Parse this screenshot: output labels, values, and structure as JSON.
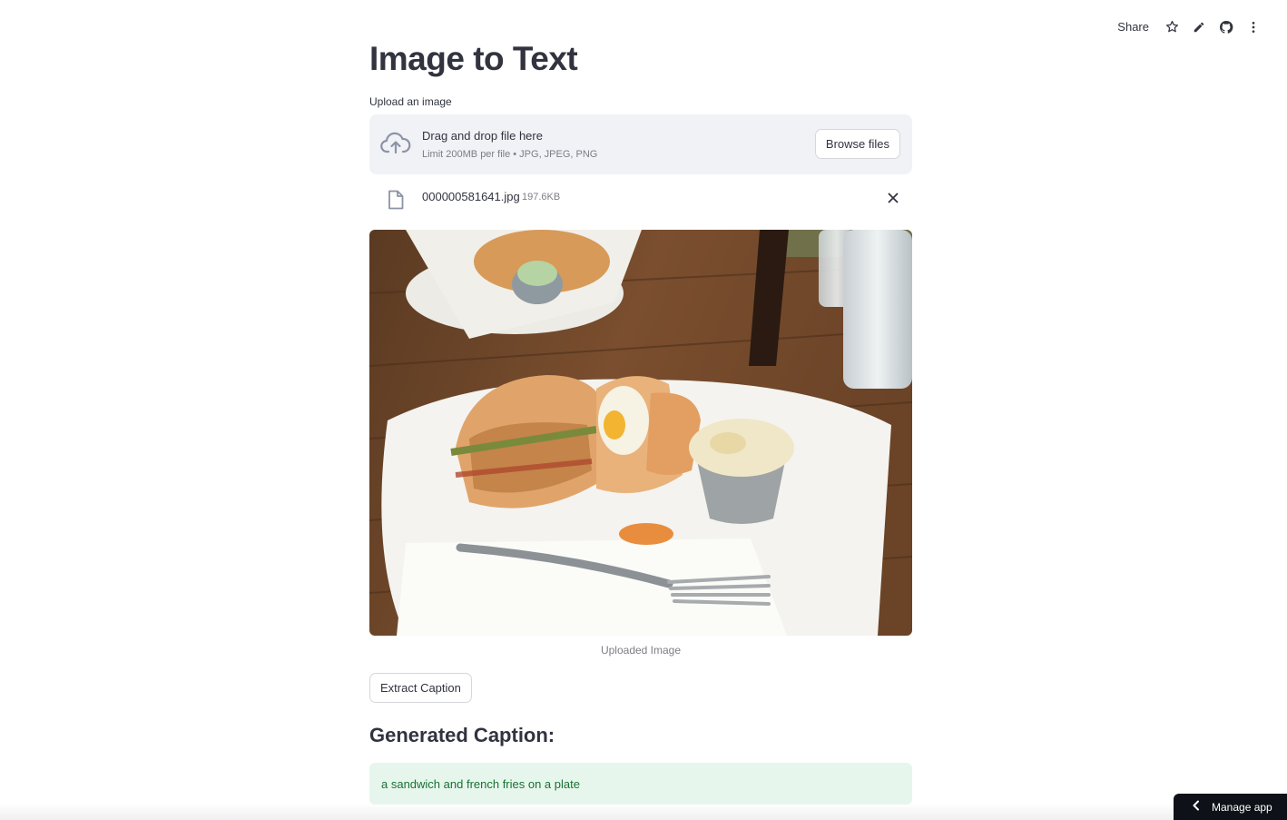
{
  "toolbar": {
    "share_label": "Share",
    "icons": [
      "star-icon",
      "pencil-icon",
      "github-icon",
      "kebab-menu-icon"
    ]
  },
  "page": {
    "title": "Image to Text"
  },
  "uploader": {
    "label": "Upload an image",
    "drop_title": "Drag and drop file here",
    "limit_text": "Limit 200MB per file • JPG, JPEG, PNG",
    "browse_label": "Browse files",
    "file": {
      "name": "000000581641.jpg",
      "size": "197.6KB"
    }
  },
  "image": {
    "caption": "Uploaded Image"
  },
  "actions": {
    "extract_label": "Extract Caption"
  },
  "result": {
    "heading": "Generated Caption:",
    "text": "a sandwich and french fries on a plate"
  },
  "footer": {
    "manage_label": "Manage app"
  },
  "colors": {
    "text": "#31333f",
    "muted": "#7c7e87",
    "dropzone_bg": "#f0f2f6",
    "success_bg": "#e7f6ec",
    "success_text": "#177233",
    "manage_bg": "#0e1117"
  }
}
